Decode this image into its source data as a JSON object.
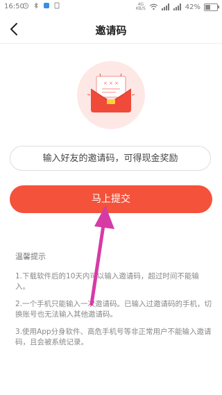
{
  "status_bar": {
    "time": "16:50",
    "network": "4G",
    "network_sub": "KB/S",
    "battery_text": "42%",
    "battery_level": 0.42
  },
  "nav": {
    "title": "邀请码"
  },
  "invite": {
    "placeholder": "输入好友的邀请码，可得现金奖励"
  },
  "submit": {
    "label": "马上提交"
  },
  "tips": {
    "title": "温馨提示",
    "items": [
      "1.下载软件后的10天内可以输入邀请码，超过时间不能输入。",
      "2.一个手机只能输入一次邀请码。已输入过邀请码的手机，切换账号也无法输入其他邀请码。",
      "3.使用App分身软件、高危手机号等非正常用户不能输入邀请码，且会被系统记录。"
    ]
  },
  "icons": {
    "back": "back-arrow-icon",
    "envelope": "red-envelope-icon",
    "annotation": "pink-arrow"
  },
  "colors": {
    "accent": "#f4523b",
    "annotation_arrow": "#d63ba5",
    "envelope_circle": "#fde8e6"
  }
}
